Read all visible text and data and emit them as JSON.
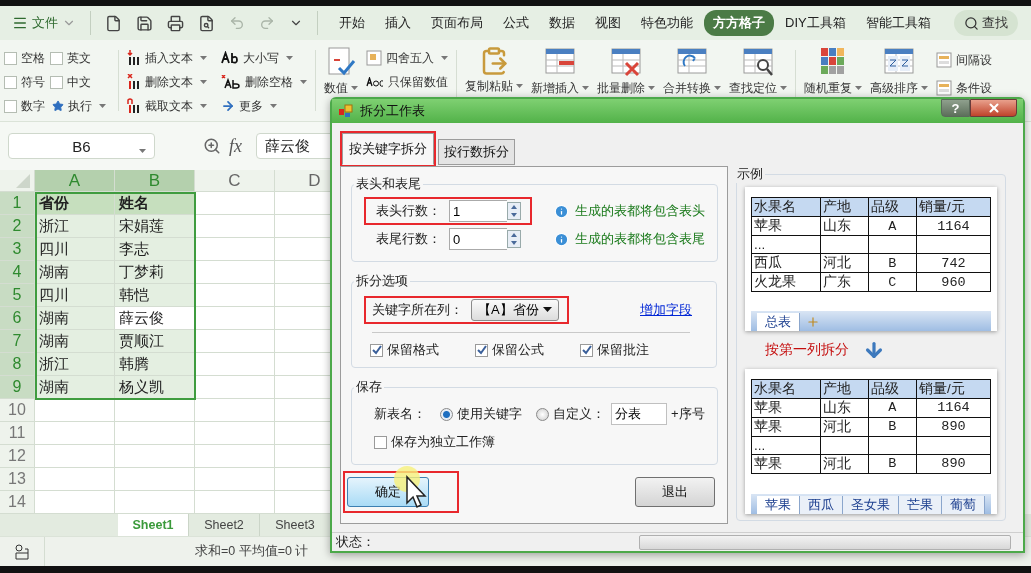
{
  "menu": {
    "file_label": "文件",
    "tabs": [
      {
        "label": "开始",
        "selected": false
      },
      {
        "label": "插入",
        "selected": false
      },
      {
        "label": "页面布局",
        "selected": false
      },
      {
        "label": "公式",
        "selected": false
      },
      {
        "label": "数据",
        "selected": false
      },
      {
        "label": "视图",
        "selected": false
      },
      {
        "label": "特色功能",
        "selected": false
      },
      {
        "label": "方方格子",
        "selected": true
      },
      {
        "label": "DIY工具箱",
        "selected": false
      },
      {
        "label": "智能工具箱",
        "selected": false
      }
    ],
    "search_label": "查找"
  },
  "ribbon": {
    "checks": [
      {
        "label": "空格",
        "checked": false
      },
      {
        "label": "英文",
        "checked": false
      },
      {
        "label": "符号",
        "checked": false
      },
      {
        "label": "中文",
        "checked": false
      },
      {
        "label": "数字",
        "checked": false
      }
    ],
    "run_label": "执行",
    "tools": [
      {
        "label": "插入文本",
        "has_menu": true
      },
      {
        "label": "大小写",
        "has_menu": true
      },
      {
        "label": "删除文本",
        "has_menu": true
      },
      {
        "label": "删除空格",
        "has_menu": true
      },
      {
        "label": "截取文本",
        "has_menu": true
      },
      {
        "label": "更多",
        "has_menu": true
      }
    ],
    "number_button": "数值",
    "number_tools": [
      {
        "label": "四舍五入",
        "has_menu": true
      },
      {
        "label": "只保留数值",
        "has_menu": false
      }
    ],
    "big_buttons": [
      {
        "label": "复制粘贴"
      },
      {
        "label": "新增插入"
      },
      {
        "label": "批量删除"
      },
      {
        "label": "合并转换"
      },
      {
        "label": "查找定位"
      },
      {
        "label": "随机重复"
      },
      {
        "label": "高级排序"
      }
    ],
    "side_tools": [
      {
        "label": "间隔设"
      },
      {
        "label": "条件设"
      }
    ]
  },
  "formula_bar": {
    "name_box": "B6",
    "fx": "fx",
    "formula": "薛云俊"
  },
  "grid": {
    "columns": [
      {
        "label": "A",
        "selected": true
      },
      {
        "label": "B",
        "selected": true
      },
      {
        "label": "C",
        "selected": false
      },
      {
        "label": "D",
        "selected": false
      }
    ],
    "rows": [
      {
        "header": "1",
        "kind": "header",
        "selected": true,
        "cells": [
          {
            "text": "省份",
            "active": false
          },
          {
            "text": "姓名",
            "active": false
          }
        ]
      },
      {
        "header": "2",
        "kind": "data",
        "selected": true,
        "cells": [
          {
            "text": "浙江",
            "active": false
          },
          {
            "text": "宋娟莲",
            "active": false
          }
        ]
      },
      {
        "header": "3",
        "kind": "data",
        "selected": true,
        "cells": [
          {
            "text": "四川",
            "active": false
          },
          {
            "text": "李志",
            "active": false
          }
        ]
      },
      {
        "header": "4",
        "kind": "data",
        "selected": true,
        "cells": [
          {
            "text": "湖南",
            "active": false
          },
          {
            "text": "丁梦莉",
            "active": false
          }
        ]
      },
      {
        "header": "5",
        "kind": "data",
        "selected": true,
        "cells": [
          {
            "text": "四川",
            "active": false
          },
          {
            "text": "韩恺",
            "active": false
          }
        ]
      },
      {
        "header": "6",
        "kind": "data",
        "selected": true,
        "cells": [
          {
            "text": "湖南",
            "active": false
          },
          {
            "text": "薛云俊",
            "active": true
          }
        ]
      },
      {
        "header": "7",
        "kind": "data",
        "selected": true,
        "cells": [
          {
            "text": "湖南",
            "active": false
          },
          {
            "text": "贾顺江",
            "active": false
          }
        ]
      },
      {
        "header": "8",
        "kind": "data",
        "selected": true,
        "cells": [
          {
            "text": "浙江",
            "active": false
          },
          {
            "text": "韩腾",
            "active": false
          }
        ]
      },
      {
        "header": "9",
        "kind": "data",
        "selected": true,
        "cells": [
          {
            "text": "湖南",
            "active": false
          },
          {
            "text": "杨义凯",
            "active": false
          }
        ]
      },
      {
        "header": "10",
        "selected": false,
        "cells": []
      },
      {
        "header": "11",
        "selected": false,
        "cells": []
      },
      {
        "header": "12",
        "selected": false,
        "cells": []
      },
      {
        "header": "13",
        "selected": false,
        "cells": []
      },
      {
        "header": "14",
        "selected": false,
        "cells": []
      }
    ]
  },
  "sheet_tabs": [
    {
      "label": "Sheet1",
      "selected": true
    },
    {
      "label": "Sheet2",
      "selected": false
    },
    {
      "label": "Sheet3",
      "selected": false
    }
  ],
  "status_bar": {
    "text": "求和=0 平均值=0 计"
  },
  "dialog": {
    "title": "拆分工作表",
    "help": "?",
    "tabs": [
      {
        "label": "按关键字拆分",
        "selected": true,
        "highlighted": true
      },
      {
        "label": "按行数拆分",
        "selected": false,
        "highlighted": false
      }
    ],
    "header_footer": {
      "title": "表头和表尾",
      "rows": [
        {
          "label": "表头行数：",
          "value": "1",
          "hint": "生成的表都将包含表头",
          "highlighted": true
        },
        {
          "label": "表尾行数：",
          "value": "0",
          "hint": "生成的表都将包含表尾",
          "highlighted": false
        }
      ]
    },
    "split_options": {
      "title": "拆分选项",
      "key_label": "关键字所在列：",
      "key_value": "【A】省份",
      "highlighted": true,
      "add_field": "增加字段",
      "checks": [
        {
          "label": "保留格式",
          "checked": true
        },
        {
          "label": "保留公式",
          "checked": true
        },
        {
          "label": "保留批注",
          "checked": true
        }
      ]
    },
    "save": {
      "title": "保存",
      "name_label": "新表名：",
      "radios": [
        {
          "label": "使用关键字",
          "selected": true
        },
        {
          "label": "自定义：",
          "selected": false
        }
      ],
      "custom_value": "分表",
      "suffix": "+序号",
      "standalone": {
        "label": "保存为独立工作簿",
        "checked": false
      }
    },
    "buttons": [
      {
        "label": "确定",
        "kind": "primary",
        "highlighted": true
      },
      {
        "label": "退出",
        "kind": "normal",
        "highlighted": false
      }
    ],
    "status_label": "状态：",
    "progress": {
      "level": 0
    },
    "example": {
      "title": "示例",
      "before": {
        "columns": [
          "水果名",
          "产地",
          "品级",
          "销量/元"
        ],
        "rows": [
          [
            "苹果",
            "山东",
            "A",
            "1164"
          ],
          [
            "...",
            "",
            "",
            ""
          ],
          [
            "西瓜",
            "河北",
            "B",
            "742"
          ],
          [
            "火龙果",
            "广东",
            "C",
            "960"
          ]
        ],
        "sheet_tabs": [
          {
            "label": "总表",
            "selected": true
          }
        ]
      },
      "caption": "按第一列拆分",
      "after": {
        "columns": [
          "水果名",
          "产地",
          "品级",
          "销量/元"
        ],
        "rows": [
          [
            "苹果",
            "山东",
            "A",
            "1164"
          ],
          [
            "苹果",
            "河北",
            "B",
            "890"
          ],
          [
            "...",
            "",
            "",
            ""
          ],
          [
            "苹果",
            "河北",
            "B",
            "890"
          ]
        ],
        "sheet_tabs": [
          {
            "label": "苹果",
            "selected": true
          },
          {
            "label": "西瓜",
            "selected": false
          },
          {
            "label": "圣女果",
            "selected": false
          },
          {
            "label": "芒果",
            "selected": false
          },
          {
            "label": "葡萄",
            "selected": false
          }
        ]
      }
    }
  }
}
